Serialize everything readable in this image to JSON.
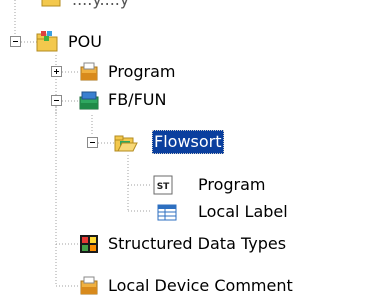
{
  "tree": {
    "root": {
      "label": "POU",
      "children": [
        {
          "label": "Program"
        },
        {
          "label": "FB/FUN",
          "children": [
            {
              "label": "Flowsort",
              "selected": true,
              "children": [
                {
                  "label": "Program",
                  "icon": "st-program-icon",
                  "icon_text": "ST"
                },
                {
                  "label": "Local Label",
                  "icon": "local-label-icon"
                }
              ]
            }
          ]
        },
        {
          "label": "Structured Data Types"
        },
        {
          "label": "Local Device Comment"
        }
      ]
    },
    "top_fragment_text": "....y....y"
  },
  "colors": {
    "selection_bg": "#0a3f9e",
    "selection_fg": "#ffffff",
    "guide_dots": "#a0a0a0",
    "folder_yellow": "#f3c84d",
    "program_orange": "#f0b040"
  }
}
